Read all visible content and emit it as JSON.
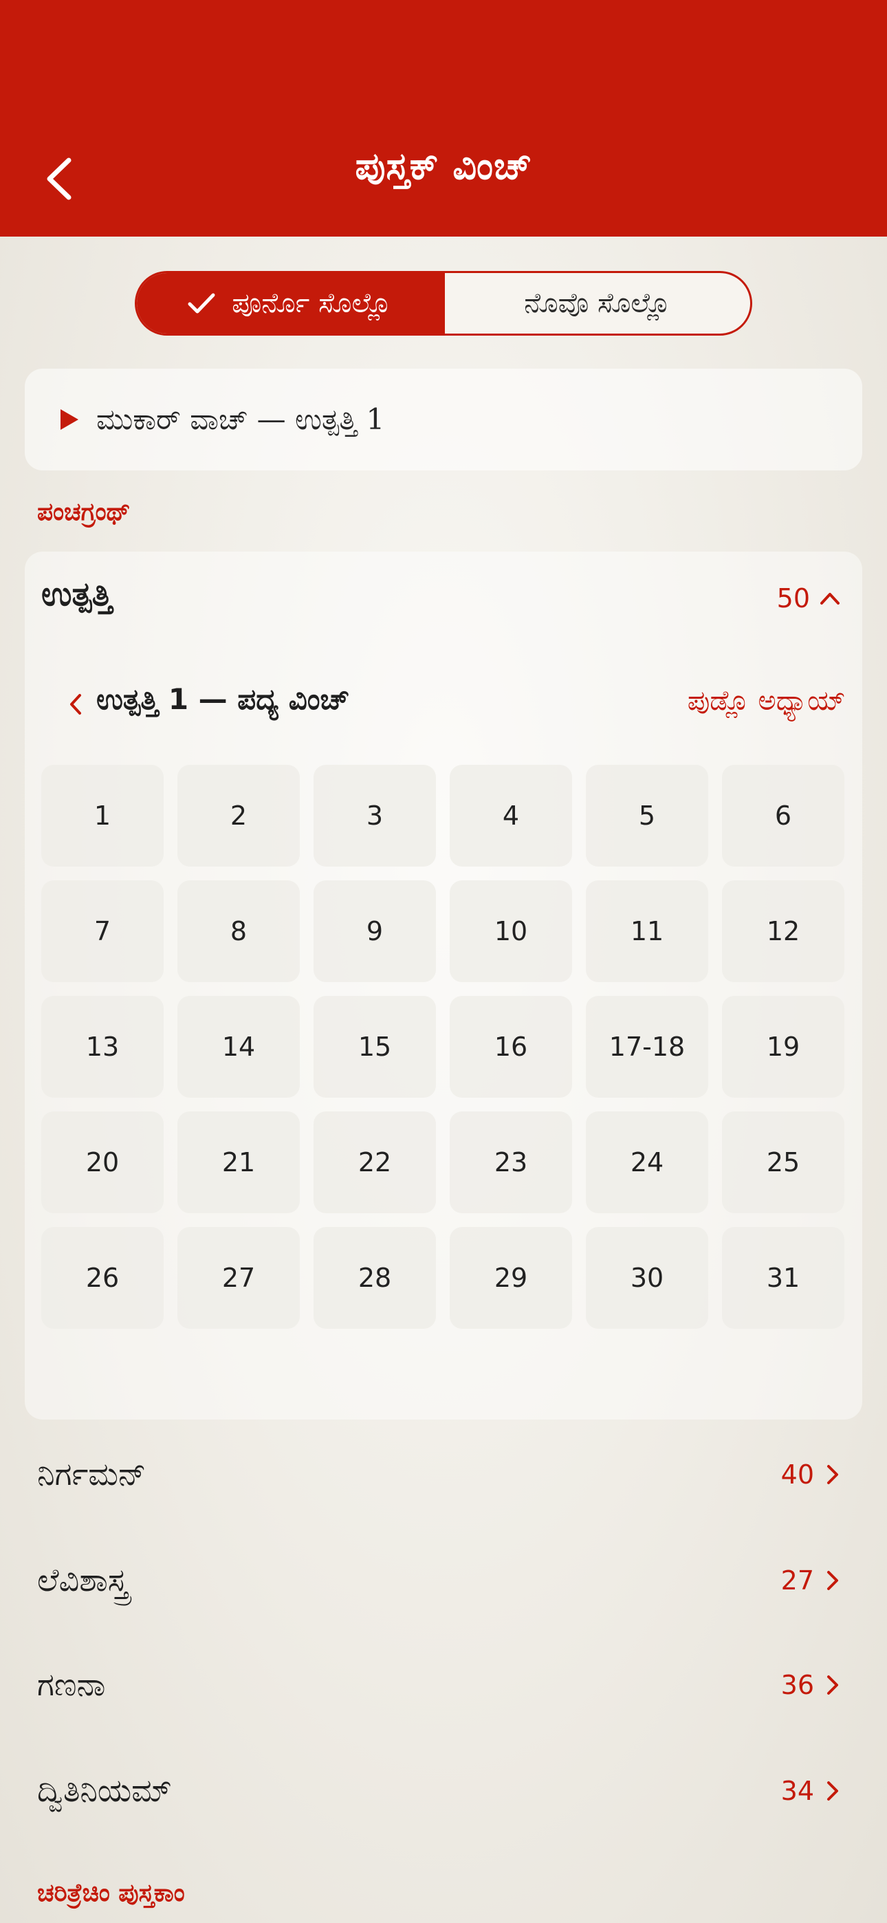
{
  "header": {
    "title": "ಪುಸ್ತಕ್ ವಿಂಚ್"
  },
  "segment": {
    "active_label": "ಪೂರ್ನೊ ಸೊಲ್ಲೊ",
    "inactive_label": "ನೊವೊ ಸೊಲ್ಲೊ"
  },
  "resume": {
    "text": "ಮುಕಾರ್ ವಾಚ್ — ಉತ್ಪತ್ತಿ 1"
  },
  "sections": {
    "first": "ಪಂಚಗ್ರಂಥ್",
    "second": "ಚರಿತ್ರೆಚಿಂ ಪುಸ್ತಕಾಂ"
  },
  "expanded_book": {
    "title": "ಉತ್ಪತ್ತಿ",
    "count": "50",
    "chapter_title": "ಉತ್ಪತ್ತಿ 1 — ಪದ್ಯ ವಿಂಚ್",
    "next_chapter": "ಪುಡ್ಲೊ ಅಧ್ಯಾಯ್",
    "verses": [
      "1",
      "2",
      "3",
      "4",
      "5",
      "6",
      "7",
      "8",
      "9",
      "10",
      "11",
      "12",
      "13",
      "14",
      "15",
      "16",
      "17-18",
      "19",
      "20",
      "21",
      "22",
      "23",
      "24",
      "25",
      "26",
      "27",
      "28",
      "29",
      "30",
      "31"
    ]
  },
  "books": [
    {
      "name": "ನಿರ್ಗಮನ್",
      "count": "40"
    },
    {
      "name": "ಲೆವಿಶಾಸ್ತ್ರ",
      "count": "27"
    },
    {
      "name": "ಗಣನಾ",
      "count": "36"
    },
    {
      "name": "ದ್ವಿತಿನಿಯಮ್",
      "count": "34"
    }
  ],
  "colors": {
    "accent": "#c41a0a",
    "background": "#eeebe4"
  },
  "icons": {
    "back": "chevron-left-icon",
    "check": "check-icon",
    "play": "play-icon",
    "collapse": "chevron-up-icon",
    "prev_chapter": "chevron-left-icon",
    "row_chevron": "chevron-right-icon"
  }
}
